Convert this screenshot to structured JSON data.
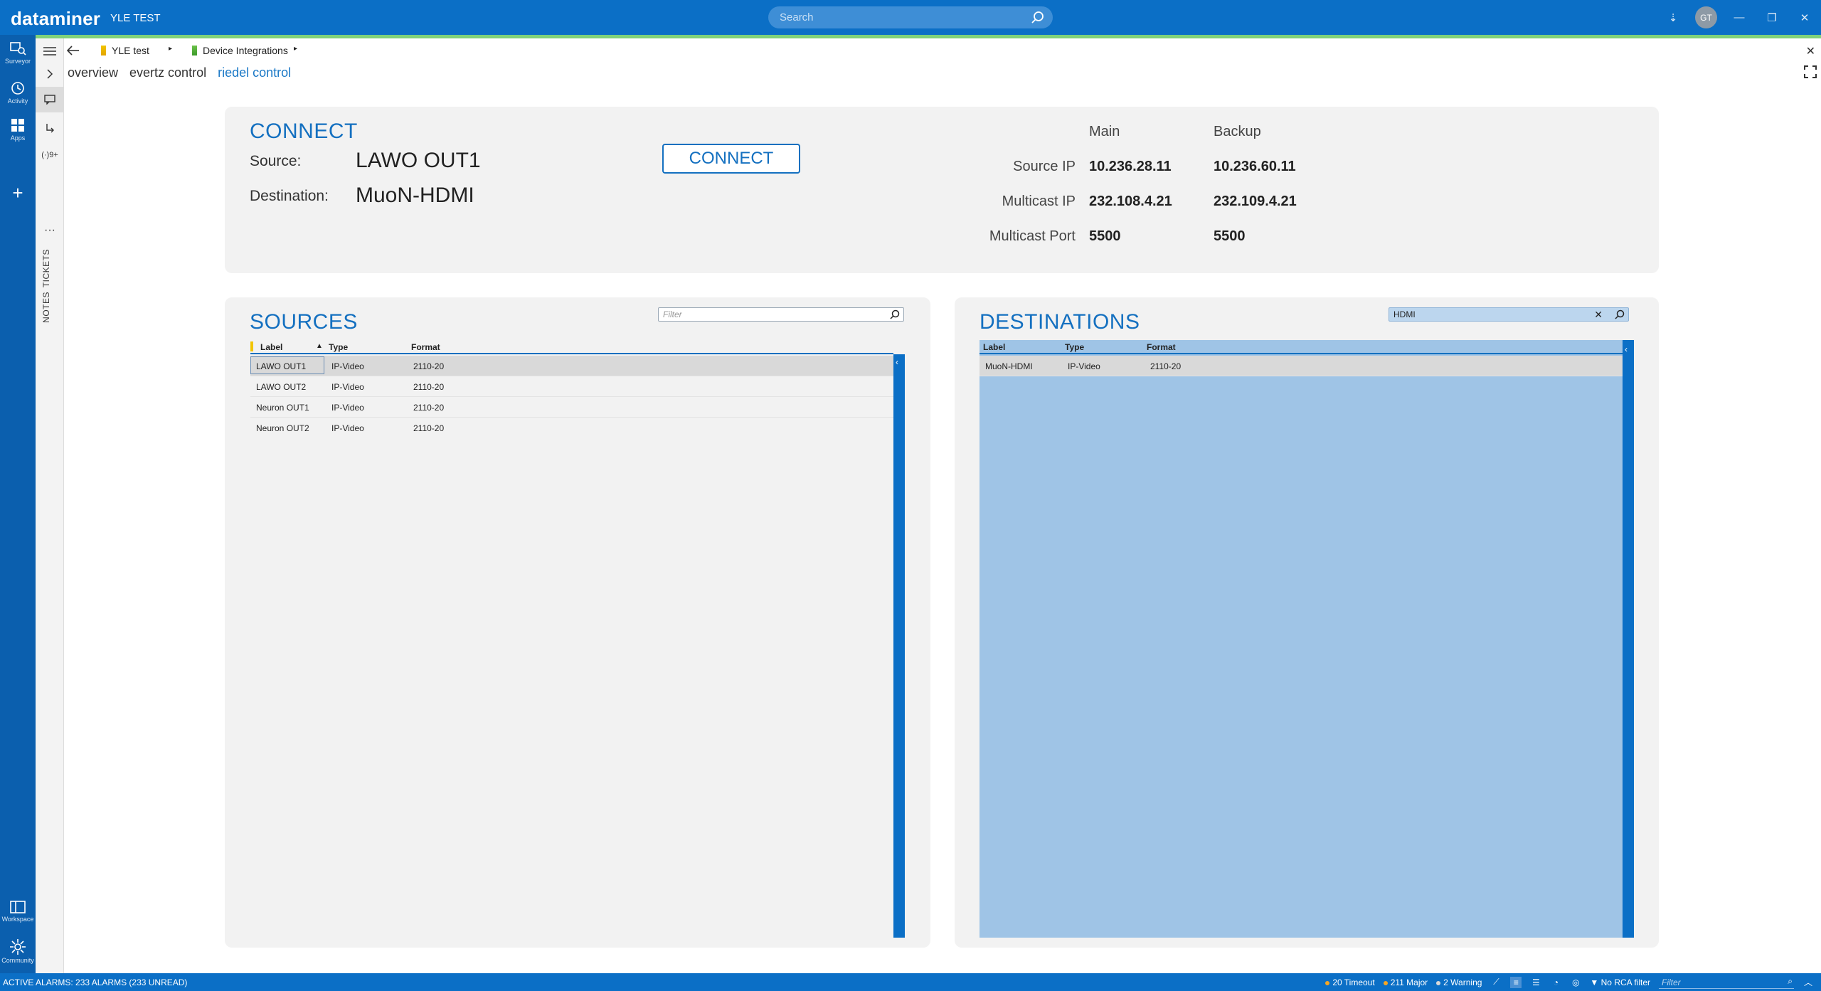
{
  "window": {
    "brand": "dataminer",
    "system_name": "YLE TEST",
    "search_placeholder": "Search",
    "avatar_initials": "GT",
    "controls": [
      "⇣",
      "—",
      "❐",
      "✕"
    ]
  },
  "left_rail": {
    "items": [
      {
        "label": "Surveyor",
        "icon": "surveyor-icon"
      },
      {
        "label": "Activity",
        "icon": "history-icon"
      },
      {
        "label": "Apps",
        "icon": "apps-icon"
      },
      {
        "label": "Workspace",
        "icon": "workspace-icon"
      },
      {
        "label": "Community",
        "icon": "community-icon"
      }
    ]
  },
  "second_rail": {
    "badge": "(·)9+",
    "more": "···",
    "tickets_label": "TICKETS",
    "notes_label": "NOTES"
  },
  "breadcrumb": {
    "items": [
      "YLE test",
      "Device Integrations"
    ]
  },
  "tabs": {
    "items": [
      {
        "label": "overview",
        "active": false
      },
      {
        "label": "evertz control",
        "active": false
      },
      {
        "label": "riedel control",
        "active": true
      }
    ]
  },
  "connect": {
    "title": "CONNECT",
    "source_label": "Source:",
    "source_value": "LAWO OUT1",
    "destination_label": "Destination:",
    "destination_value": "MuoN-HDMI",
    "button_label": "CONNECT",
    "col_main": "Main",
    "col_backup": "Backup",
    "rows": [
      {
        "label": "Source IP",
        "main": "10.236.28.11",
        "backup": "10.236.60.11"
      },
      {
        "label": "Multicast IP",
        "main": "232.108.4.21",
        "backup": "232.109.4.21"
      },
      {
        "label": "Multicast Port",
        "main": "5500",
        "backup": "5500"
      }
    ]
  },
  "sources": {
    "title": "SOURCES",
    "filter_placeholder": "Filter",
    "columns": [
      "Label",
      "Type",
      "Format"
    ],
    "rows": [
      {
        "label": "LAWO OUT1",
        "type": "IP-Video",
        "format": "2110-20",
        "selected": true
      },
      {
        "label": "LAWO OUT2",
        "type": "IP-Video",
        "format": "2110-20",
        "selected": false
      },
      {
        "label": "Neuron OUT1",
        "type": "IP-Video",
        "format": "2110-20",
        "selected": false
      },
      {
        "label": "Neuron OUT2",
        "type": "IP-Video",
        "format": "2110-20",
        "selected": false
      }
    ]
  },
  "destinations": {
    "title": "DESTINATIONS",
    "filter_value": "HDMI",
    "columns": [
      "Label",
      "Type",
      "Format"
    ],
    "rows": [
      {
        "label": "MuoN-HDMI",
        "type": "IP-Video",
        "format": "2110-20",
        "selected": true
      }
    ]
  },
  "statusbar": {
    "alarm_summary": "ACTIVE ALARMS: 233 ALARMS (233 UNREAD)",
    "timeout": "20 Timeout",
    "major": "211 Major",
    "warning": "2 Warning",
    "rca_filter": "No RCA filter",
    "filter_placeholder": "Filter",
    "colors": {
      "timeout": "#f5a623",
      "major": "#f5a623",
      "warning": "#d8d8d8"
    }
  },
  "colors": {
    "titlebar": "#0b6fc6",
    "rail": "#0b5fae",
    "accent_green": "#7fd17a",
    "panel_title": "#1470c0",
    "dest_selection": "#9fc4e6"
  }
}
